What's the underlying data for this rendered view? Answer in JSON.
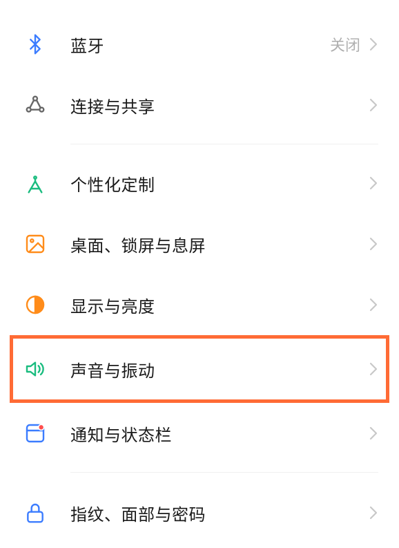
{
  "settings": {
    "items": [
      {
        "label": "蓝牙",
        "status": "关闭",
        "icon": "bluetooth",
        "color": "#3b7cff"
      },
      {
        "label": "连接与共享",
        "status": "",
        "icon": "share",
        "color": "#666"
      },
      {
        "label": "个性化定制",
        "status": "",
        "icon": "compass",
        "color": "#1abc7f"
      },
      {
        "label": "桌面、锁屏与息屏",
        "status": "",
        "icon": "wallpaper",
        "color": "#ff8c1a"
      },
      {
        "label": "显示与亮度",
        "status": "",
        "icon": "brightness",
        "color": "#ff8c1a"
      },
      {
        "label": "声音与振动",
        "status": "",
        "icon": "sound",
        "color": "#1abc7f"
      },
      {
        "label": "通知与状态栏",
        "status": "",
        "icon": "notification",
        "color": "#3b7cff"
      },
      {
        "label": "指纹、面部与密码",
        "status": "",
        "icon": "lock",
        "color": "#3b7cff"
      }
    ]
  }
}
